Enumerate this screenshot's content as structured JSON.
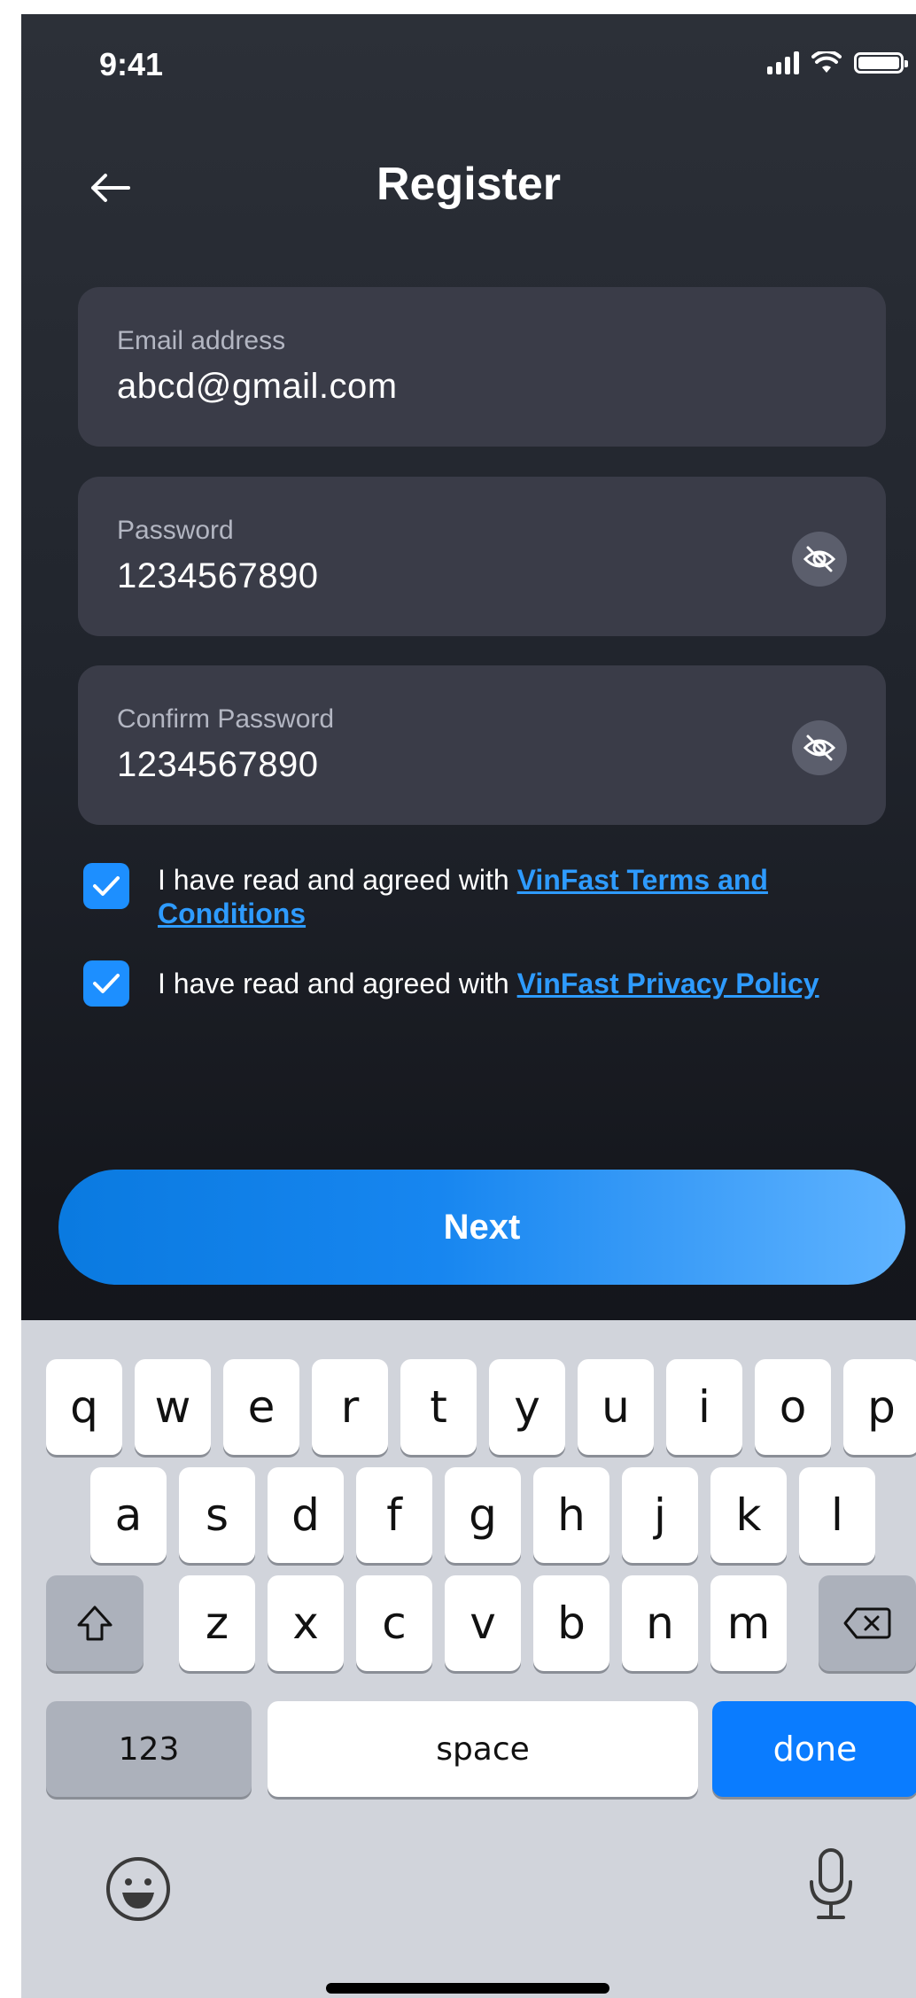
{
  "status_bar": {
    "time": "9:41"
  },
  "header": {
    "title": "Register"
  },
  "fields": [
    {
      "label": "Email address",
      "value": "abcd@gmail.com"
    },
    {
      "label": "Password",
      "value": "1234567890"
    },
    {
      "label": "Confirm Password",
      "value": "1234567890"
    }
  ],
  "agreements": [
    {
      "prefix": "I have read and agreed with ",
      "link": "VinFast Terms and Conditions",
      "checked": true
    },
    {
      "prefix": "I have read and agreed with ",
      "link": "VinFast Privacy Policy",
      "checked": true
    }
  ],
  "next_button": {
    "label": "Next"
  },
  "keyboard": {
    "row1": [
      "q",
      "w",
      "e",
      "r",
      "t",
      "y",
      "u",
      "i",
      "o",
      "p"
    ],
    "row2": [
      "a",
      "s",
      "d",
      "f",
      "g",
      "h",
      "j",
      "k",
      "l"
    ],
    "row3": [
      "z",
      "x",
      "c",
      "v",
      "b",
      "n",
      "m"
    ],
    "numbers_key": "123",
    "space_key": "space",
    "done_key": "done"
  },
  "colors": {
    "accent": "#1d8fff",
    "link": "#2e9bff",
    "keyboard_bg": "#d1d4db",
    "done_key": "#0a7cff"
  }
}
